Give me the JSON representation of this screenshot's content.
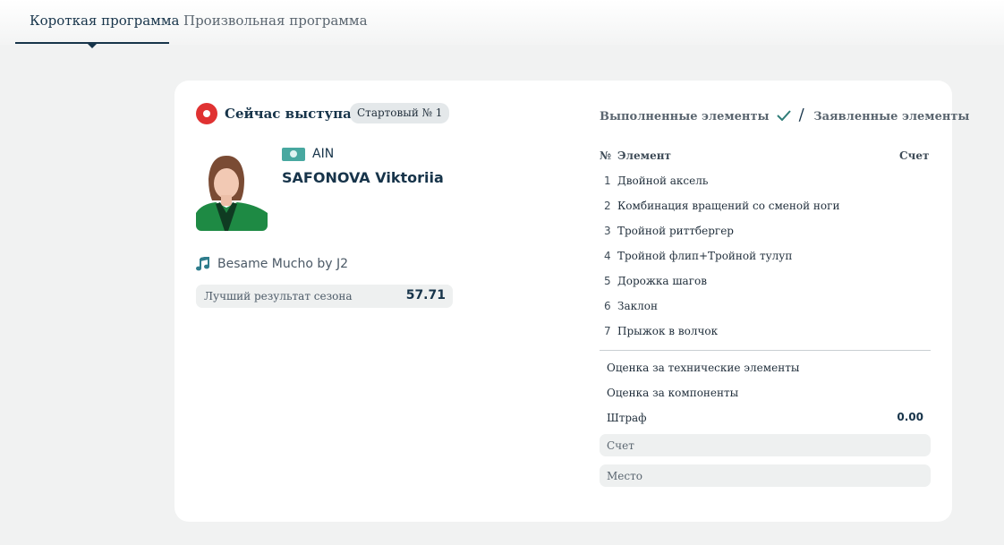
{
  "tabs": [
    {
      "label": "Короткая программа",
      "active": true
    },
    {
      "label": "Произвольная программа",
      "active": false
    }
  ],
  "performer": {
    "now_label": "Сейчас выступает",
    "start_badge": "Стартовый № 1",
    "country": "AIN",
    "name": "SAFONOVA Viktoriia",
    "music": "Besame Mucho by J2",
    "best_label": "Лучший результат сезона",
    "best_value": "57.71"
  },
  "elements": {
    "executed_label": "Выполненные элементы",
    "slash": "/",
    "declared_label": "Заявленные элементы",
    "col_no": "№",
    "col_element": "Элемент",
    "col_score": "Счет",
    "rows": [
      {
        "no": "1",
        "name": "Двойной аксель"
      },
      {
        "no": "2",
        "name": "Комбинация вращений со сменой ноги"
      },
      {
        "no": "3",
        "name": "Тройной риттбергер"
      },
      {
        "no": "4",
        "name": "Тройной флип+Тройной тулуп"
      },
      {
        "no": "5",
        "name": "Дорожка шагов"
      },
      {
        "no": "6",
        "name": "Заклон"
      },
      {
        "no": "7",
        "name": "Прыжок в волчок"
      }
    ]
  },
  "summary": {
    "tech_label": "Оценка за технические элементы",
    "components_label": "Оценка за компоненты",
    "penalty_label": "Штраф",
    "penalty_value": "0.00",
    "score_label": "Счет",
    "place_label": "Место"
  },
  "colors": {
    "accent": "#17344a",
    "live": "#e03232",
    "flag": "#48a8a0",
    "check": "#2f7d78",
    "music": "#2f7d8c"
  },
  "icons": {
    "live": "record-icon",
    "flag": "ain-flag-icon",
    "music": "music-note-icon",
    "check": "check-icon"
  }
}
